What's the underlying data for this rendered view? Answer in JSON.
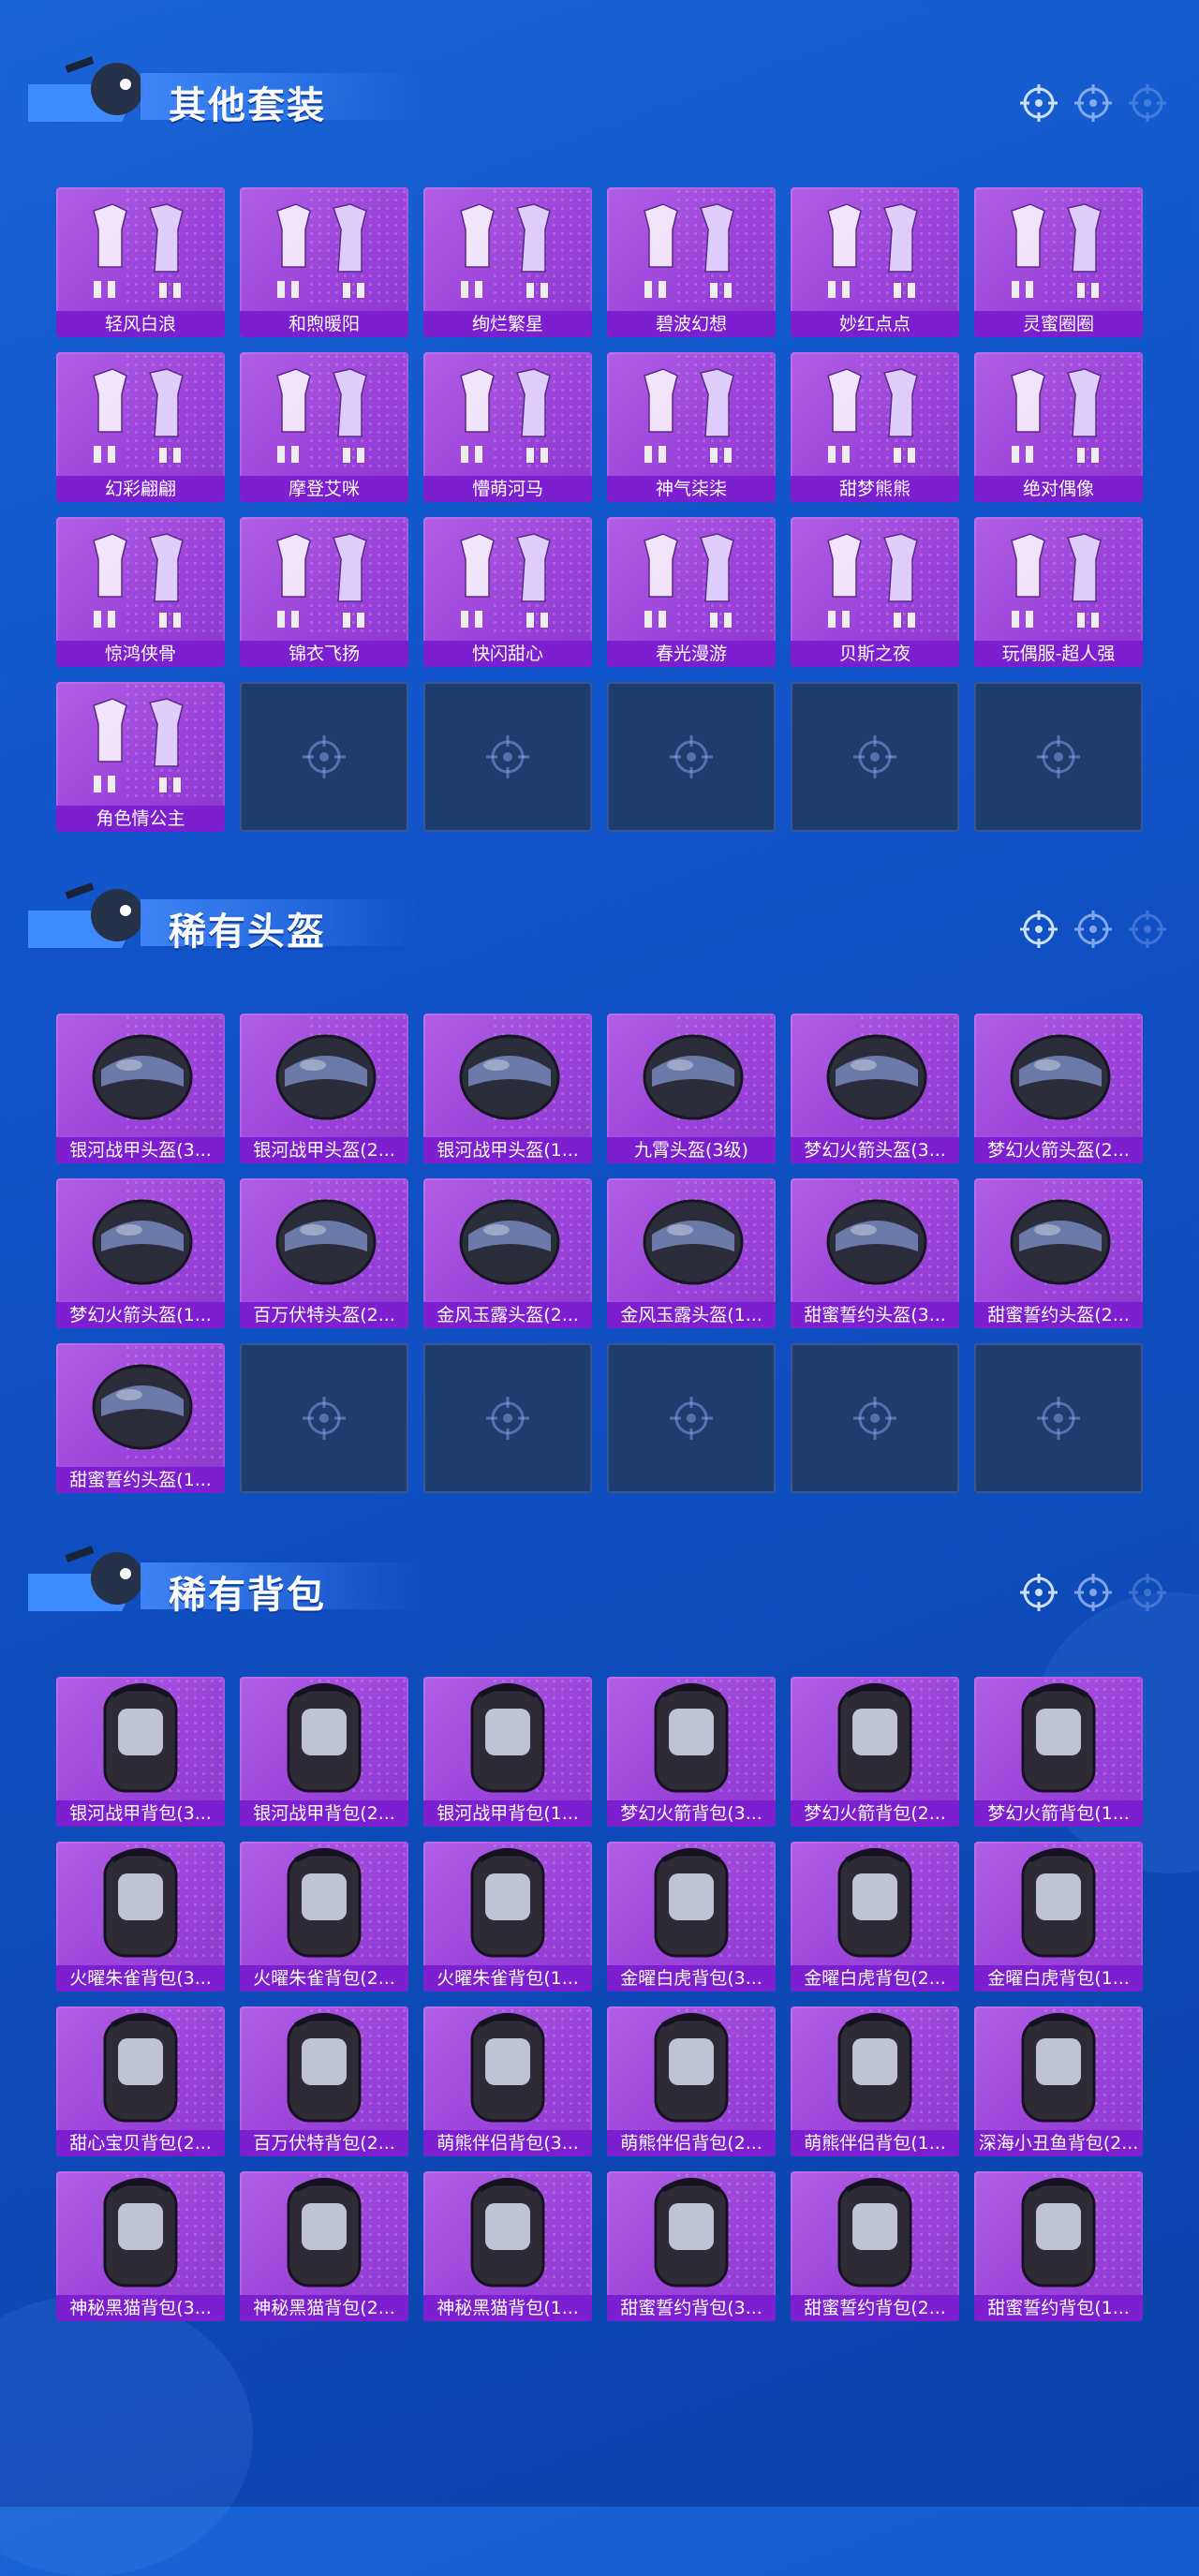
{
  "colors": {
    "background": "#1152c9",
    "card": "#a24ae0",
    "label_bar": "#7d1fd0",
    "empty_card": "#1f3c6f"
  },
  "sections": [
    {
      "title": "其他套装",
      "items": [
        "轻风白浪",
        "和煦暖阳",
        "绚烂繁星",
        "碧波幻想",
        "妙红点点",
        "灵蜜圈圈",
        "幻彩翩翩",
        "摩登艾咪",
        "懵萌河马",
        "神气柒柒",
        "甜梦熊熊",
        "绝对偶像",
        "惊鸿侠骨",
        "锦衣飞扬",
        "快闪甜心",
        "春光漫游",
        "贝斯之夜",
        "玩偶服-超人强",
        "角色情公主"
      ],
      "empty_slots": 5
    },
    {
      "title": "稀有头盔",
      "items": [
        "银河战甲头盔(3...",
        "银河战甲头盔(2...",
        "银河战甲头盔(1...",
        "九霄头盔(3级)",
        "梦幻火箭头盔(3...",
        "梦幻火箭头盔(2...",
        "梦幻火箭头盔(1...",
        "百万伏特头盔(2...",
        "金风玉露头盔(2...",
        "金风玉露头盔(1...",
        "甜蜜誓约头盔(3...",
        "甜蜜誓约头盔(2...",
        "甜蜜誓约头盔(1..."
      ],
      "empty_slots": 5
    },
    {
      "title": "稀有背包",
      "items": [
        "银河战甲背包(3...",
        "银河战甲背包(2...",
        "银河战甲背包(1...",
        "梦幻火箭背包(3...",
        "梦幻火箭背包(2...",
        "梦幻火箭背包(1...",
        "火曜朱雀背包(3...",
        "火曜朱雀背包(2...",
        "火曜朱雀背包(1...",
        "金曜白虎背包(3...",
        "金曜白虎背包(2...",
        "金曜白虎背包(1...",
        "甜心宝贝背包(2...",
        "百万伏特背包(2...",
        "萌熊伴侣背包(3...",
        "萌熊伴侣背包(2...",
        "萌熊伴侣背包(1...",
        "深海小丑鱼背包(2...",
        "神秘黑猫背包(3...",
        "神秘黑猫背包(2...",
        "神秘黑猫背包(1...",
        "甜蜜誓约背包(3...",
        "甜蜜誓约背包(2...",
        "甜蜜誓约背包(1..."
      ],
      "empty_slots": 0
    }
  ]
}
